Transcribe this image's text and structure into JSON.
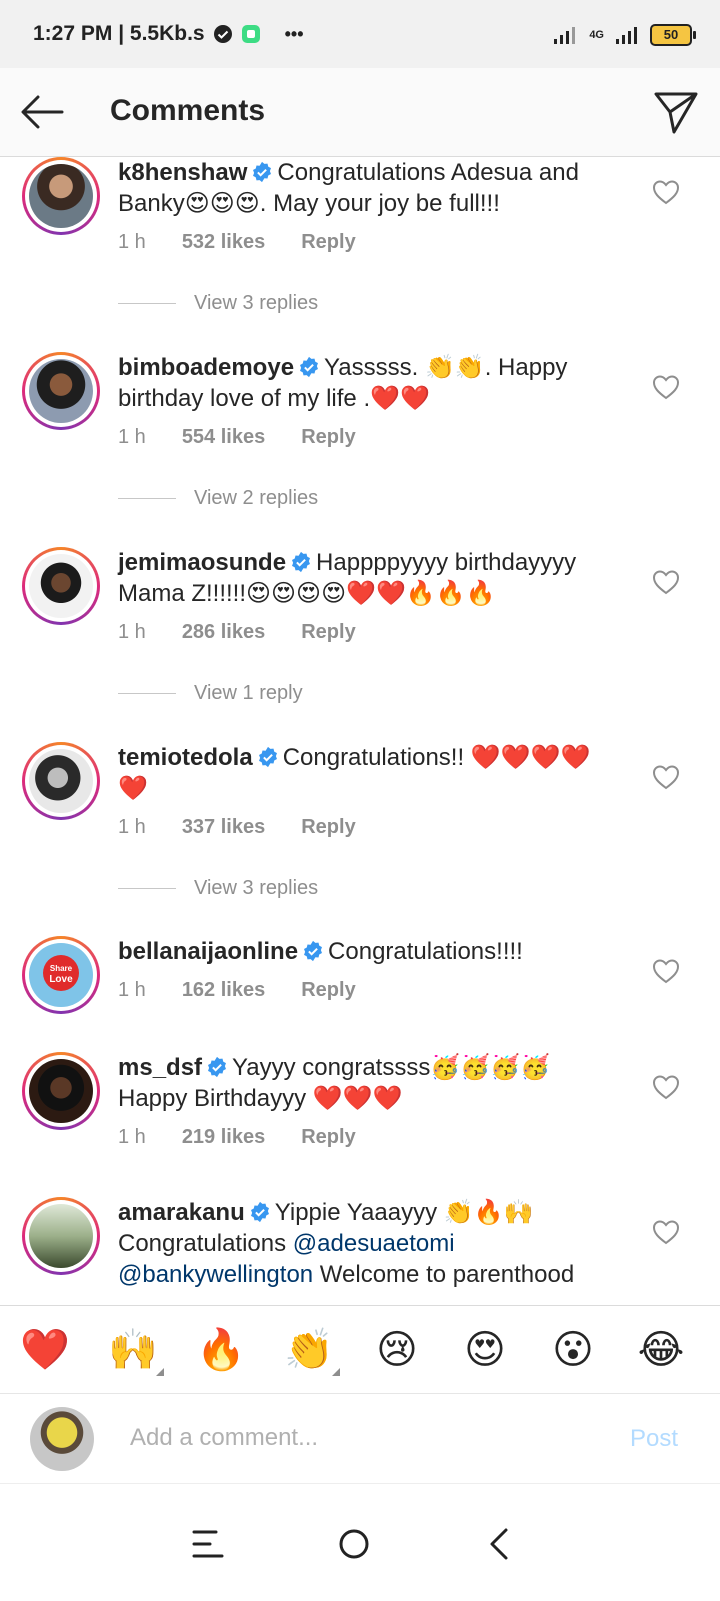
{
  "status": {
    "time": "1:27 PM | 5.5Kb.s",
    "dots": "•••",
    "network": "4G",
    "battery": "50"
  },
  "header": {
    "title": "Comments"
  },
  "comments": [
    {
      "username": "k8henshaw",
      "text": "Congratulations Adesua and Banky😍😍😍. May your joy be full!!!",
      "time": "1 h",
      "likes": "532 likes",
      "reply": "Reply",
      "view_replies": "View 3 replies"
    },
    {
      "username": "bimboademoye",
      "text": "Yasssss. 👏👏. Happy birthday love of my life .❤️❤️",
      "time": "1 h",
      "likes": "554 likes",
      "reply": "Reply",
      "view_replies": "View 2 replies"
    },
    {
      "username": "jemimaosunde",
      "text": "Happppyyyy birthdayyyy Mama Z!!!!!!😍😍😍😍❤️❤️🔥🔥🔥",
      "time": "1 h",
      "likes": "286 likes",
      "reply": "Reply",
      "view_replies": "View 1 reply"
    },
    {
      "username": "temiotedola",
      "text": "Congratulations!! ❤️❤️❤️❤️❤️",
      "time": "1 h",
      "likes": "337 likes",
      "reply": "Reply",
      "view_replies": "View 3 replies"
    },
    {
      "username": "bellanaijaonline",
      "text": "Congratulations!!!!",
      "time": "1 h",
      "likes": "162 likes",
      "reply": "Reply",
      "avatar_badge_top": "Share",
      "avatar_badge_bottom": "Love"
    },
    {
      "username": "ms_dsf",
      "text": "Yayyy congratssss🥳🥳🥳🥳 Happy Birthdayyy ❤️❤️❤️",
      "time": "1 h",
      "likes": "219 likes",
      "reply": "Reply"
    },
    {
      "username": "amarakanu",
      "text_before": "Yippie Yaaayyy 👏🔥🙌 Congratulations ",
      "mention1": "@adesuaetomi",
      "mention2": "@bankywellington",
      "text_after": " Welcome to parenthood"
    }
  ],
  "emoji_bar": [
    "❤️",
    "🙌",
    "🔥",
    "👏",
    "😢",
    "😍",
    "😮",
    "😂"
  ],
  "composer": {
    "placeholder": "Add a comment...",
    "post_label": "Post"
  },
  "colors": {
    "accent": "#0095f6",
    "verified": "#3897f0",
    "post_disabled": "#b3dbff"
  }
}
